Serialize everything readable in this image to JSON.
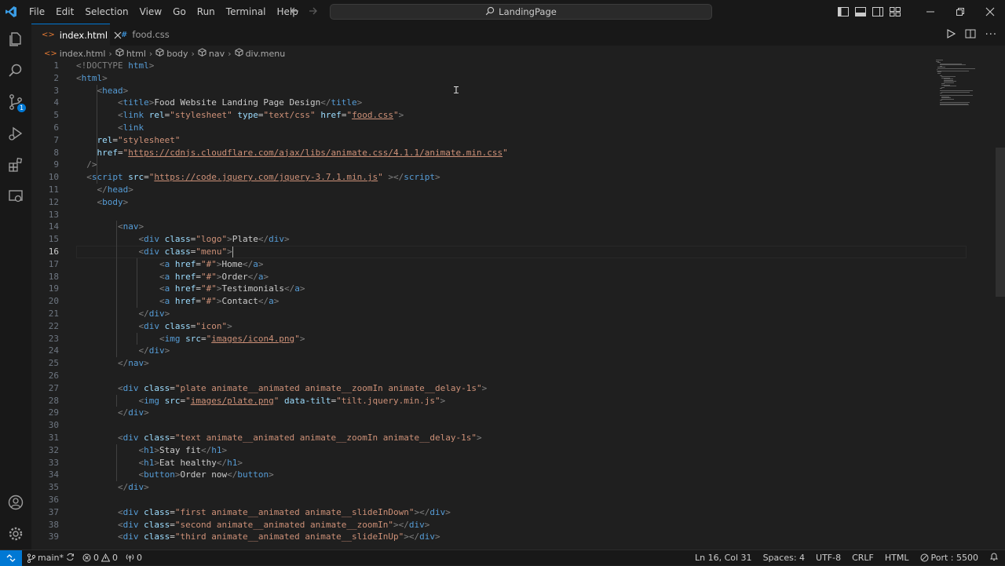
{
  "titlebar": {
    "menu": [
      "File",
      "Edit",
      "Selection",
      "View",
      "Go",
      "Run",
      "Terminal",
      "Help"
    ],
    "search_text": "LandingPage"
  },
  "tabs": [
    {
      "label": "index.html",
      "icon": "<>",
      "active": true
    },
    {
      "label": "food.css",
      "icon": "#",
      "active": false
    }
  ],
  "activity_badge": "1",
  "breadcrumb": [
    "index.html",
    "html",
    "body",
    "nav",
    "div.menu"
  ],
  "editor": {
    "current_line": 16,
    "lines": [
      [
        [
          "tg",
          "<!DOCTYPE "
        ],
        [
          "tn",
          "html"
        ],
        [
          "tg",
          ">"
        ]
      ],
      [
        [
          "tg",
          "<"
        ],
        [
          "tn",
          "html"
        ],
        [
          "tg",
          ">"
        ]
      ],
      [
        [
          "tx",
          "    "
        ],
        [
          "tg",
          "<"
        ],
        [
          "tn",
          "head"
        ],
        [
          "tg",
          ">"
        ]
      ],
      [
        [
          "tx",
          "        "
        ],
        [
          "tg",
          "<"
        ],
        [
          "tn",
          "title"
        ],
        [
          "tg",
          ">"
        ],
        [
          "tx",
          "Food Website Landing Page Design"
        ],
        [
          "tg",
          "</"
        ],
        [
          "tn",
          "title"
        ],
        [
          "tg",
          ">"
        ]
      ],
      [
        [
          "tx",
          "        "
        ],
        [
          "tg",
          "<"
        ],
        [
          "tn",
          "link "
        ],
        [
          "an",
          "rel"
        ],
        [
          "tx",
          "="
        ],
        [
          "av",
          "\"stylesheet\" "
        ],
        [
          "an",
          "type"
        ],
        [
          "tx",
          "="
        ],
        [
          "av",
          "\"text/css\" "
        ],
        [
          "an",
          "href"
        ],
        [
          "tx",
          "="
        ],
        [
          "av",
          "\""
        ],
        [
          "avu",
          "food.css"
        ],
        [
          "av",
          "\""
        ],
        [
          "tg",
          ">"
        ]
      ],
      [
        [
          "tx",
          "        "
        ],
        [
          "tg",
          "<"
        ],
        [
          "tn",
          "link"
        ]
      ],
      [
        [
          "tx",
          "    "
        ],
        [
          "an",
          "rel"
        ],
        [
          "tx",
          "="
        ],
        [
          "av",
          "\"stylesheet\""
        ]
      ],
      [
        [
          "tx",
          "    "
        ],
        [
          "an",
          "href"
        ],
        [
          "tx",
          "="
        ],
        [
          "av",
          "\""
        ],
        [
          "avu",
          "https://cdnjs.cloudflare.com/ajax/libs/animate.css/4.1.1/animate.min.css"
        ],
        [
          "av",
          "\""
        ]
      ],
      [
        [
          "tx",
          "  "
        ],
        [
          "tg",
          "/>"
        ]
      ],
      [
        [
          "tx",
          "  "
        ],
        [
          "tg",
          "<"
        ],
        [
          "tn",
          "script "
        ],
        [
          "an",
          "src"
        ],
        [
          "tx",
          "="
        ],
        [
          "av",
          "\""
        ],
        [
          "avu",
          "https://code.jquery.com/jquery-3.7.1.min.js"
        ],
        [
          "av",
          "\" "
        ],
        [
          "tg",
          "></"
        ],
        [
          "tn",
          "script"
        ],
        [
          "tg",
          ">"
        ]
      ],
      [
        [
          "tx",
          "    "
        ],
        [
          "tg",
          "</"
        ],
        [
          "tn",
          "head"
        ],
        [
          "tg",
          ">"
        ]
      ],
      [
        [
          "tx",
          "    "
        ],
        [
          "tg",
          "<"
        ],
        [
          "tn",
          "body"
        ],
        [
          "tg",
          ">"
        ]
      ],
      [],
      [
        [
          "tx",
          "        "
        ],
        [
          "tg",
          "<"
        ],
        [
          "tn",
          "nav"
        ],
        [
          "tg",
          ">"
        ]
      ],
      [
        [
          "tx",
          "            "
        ],
        [
          "tg",
          "<"
        ],
        [
          "tn",
          "div "
        ],
        [
          "an",
          "class"
        ],
        [
          "tx",
          "="
        ],
        [
          "av",
          "\"logo\""
        ],
        [
          "tg",
          ">"
        ],
        [
          "tx",
          "Plate"
        ],
        [
          "tg",
          "</"
        ],
        [
          "tn",
          "div"
        ],
        [
          "tg",
          ">"
        ]
      ],
      [
        [
          "tx",
          "            "
        ],
        [
          "tg",
          "<"
        ],
        [
          "tn",
          "div "
        ],
        [
          "an",
          "class"
        ],
        [
          "tx",
          "="
        ],
        [
          "av",
          "\"menu\""
        ],
        [
          "tg",
          ">"
        ],
        [
          "cur",
          ""
        ]
      ],
      [
        [
          "tx",
          "                "
        ],
        [
          "tg",
          "<"
        ],
        [
          "tn",
          "a "
        ],
        [
          "an",
          "href"
        ],
        [
          "tx",
          "="
        ],
        [
          "av",
          "\"#\""
        ],
        [
          "tg",
          ">"
        ],
        [
          "tx",
          "Home"
        ],
        [
          "tg",
          "</"
        ],
        [
          "tn",
          "a"
        ],
        [
          "tg",
          ">"
        ]
      ],
      [
        [
          "tx",
          "                "
        ],
        [
          "tg",
          "<"
        ],
        [
          "tn",
          "a "
        ],
        [
          "an",
          "href"
        ],
        [
          "tx",
          "="
        ],
        [
          "av",
          "\"#\""
        ],
        [
          "tg",
          ">"
        ],
        [
          "tx",
          "Order"
        ],
        [
          "tg",
          "</"
        ],
        [
          "tn",
          "a"
        ],
        [
          "tg",
          ">"
        ]
      ],
      [
        [
          "tx",
          "                "
        ],
        [
          "tg",
          "<"
        ],
        [
          "tn",
          "a "
        ],
        [
          "an",
          "href"
        ],
        [
          "tx",
          "="
        ],
        [
          "av",
          "\"#\""
        ],
        [
          "tg",
          ">"
        ],
        [
          "tx",
          "Testimonials"
        ],
        [
          "tg",
          "</"
        ],
        [
          "tn",
          "a"
        ],
        [
          "tg",
          ">"
        ]
      ],
      [
        [
          "tx",
          "                "
        ],
        [
          "tg",
          "<"
        ],
        [
          "tn",
          "a "
        ],
        [
          "an",
          "href"
        ],
        [
          "tx",
          "="
        ],
        [
          "av",
          "\"#\""
        ],
        [
          "tg",
          ">"
        ],
        [
          "tx",
          "Contact"
        ],
        [
          "tg",
          "</"
        ],
        [
          "tn",
          "a"
        ],
        [
          "tg",
          ">"
        ]
      ],
      [
        [
          "tx",
          "            "
        ],
        [
          "tg",
          "</"
        ],
        [
          "tn",
          "div"
        ],
        [
          "tg",
          ">"
        ]
      ],
      [
        [
          "tx",
          "            "
        ],
        [
          "tg",
          "<"
        ],
        [
          "tn",
          "div "
        ],
        [
          "an",
          "class"
        ],
        [
          "tx",
          "="
        ],
        [
          "av",
          "\"icon\""
        ],
        [
          "tg",
          ">"
        ]
      ],
      [
        [
          "tx",
          "                "
        ],
        [
          "tg",
          "<"
        ],
        [
          "tn",
          "img "
        ],
        [
          "an",
          "src"
        ],
        [
          "tx",
          "="
        ],
        [
          "av",
          "\""
        ],
        [
          "avu",
          "images/icon4.png"
        ],
        [
          "av",
          "\""
        ],
        [
          "tg",
          ">"
        ]
      ],
      [
        [
          "tx",
          "            "
        ],
        [
          "tg",
          "</"
        ],
        [
          "tn",
          "div"
        ],
        [
          "tg",
          ">"
        ]
      ],
      [
        [
          "tx",
          "        "
        ],
        [
          "tg",
          "</"
        ],
        [
          "tn",
          "nav"
        ],
        [
          "tg",
          ">"
        ]
      ],
      [],
      [
        [
          "tx",
          "        "
        ],
        [
          "tg",
          "<"
        ],
        [
          "tn",
          "div "
        ],
        [
          "an",
          "class"
        ],
        [
          "tx",
          "="
        ],
        [
          "av",
          "\"plate animate__animated animate__zoomIn animate__delay-1s\""
        ],
        [
          "tg",
          ">"
        ]
      ],
      [
        [
          "tx",
          "            "
        ],
        [
          "tg",
          "<"
        ],
        [
          "tn",
          "img "
        ],
        [
          "an",
          "src"
        ],
        [
          "tx",
          "="
        ],
        [
          "av",
          "\""
        ],
        [
          "avu",
          "images/plate.png"
        ],
        [
          "av",
          "\" "
        ],
        [
          "an",
          "data-tilt"
        ],
        [
          "tx",
          "="
        ],
        [
          "av",
          "\"tilt.jquery.min.js\""
        ],
        [
          "tg",
          ">"
        ]
      ],
      [
        [
          "tx",
          "        "
        ],
        [
          "tg",
          "</"
        ],
        [
          "tn",
          "div"
        ],
        [
          "tg",
          ">"
        ]
      ],
      [],
      [
        [
          "tx",
          "        "
        ],
        [
          "tg",
          "<"
        ],
        [
          "tn",
          "div "
        ],
        [
          "an",
          "class"
        ],
        [
          "tx",
          "="
        ],
        [
          "av",
          "\"text animate__animated animate__zoomIn animate__delay-1s\""
        ],
        [
          "tg",
          ">"
        ]
      ],
      [
        [
          "tx",
          "            "
        ],
        [
          "tg",
          "<"
        ],
        [
          "tn",
          "h1"
        ],
        [
          "tg",
          ">"
        ],
        [
          "tx",
          "Stay fit"
        ],
        [
          "tg",
          "</"
        ],
        [
          "tn",
          "h1"
        ],
        [
          "tg",
          ">"
        ]
      ],
      [
        [
          "tx",
          "            "
        ],
        [
          "tg",
          "<"
        ],
        [
          "tn",
          "h1"
        ],
        [
          "tg",
          ">"
        ],
        [
          "tx",
          "Eat healthy"
        ],
        [
          "tg",
          "</"
        ],
        [
          "tn",
          "h1"
        ],
        [
          "tg",
          ">"
        ]
      ],
      [
        [
          "tx",
          "            "
        ],
        [
          "tg",
          "<"
        ],
        [
          "tn",
          "button"
        ],
        [
          "tg",
          ">"
        ],
        [
          "tx",
          "Order now"
        ],
        [
          "tg",
          "</"
        ],
        [
          "tn",
          "button"
        ],
        [
          "tg",
          ">"
        ]
      ],
      [
        [
          "tx",
          "        "
        ],
        [
          "tg",
          "</"
        ],
        [
          "tn",
          "div"
        ],
        [
          "tg",
          ">"
        ]
      ],
      [],
      [
        [
          "tx",
          "        "
        ],
        [
          "tg",
          "<"
        ],
        [
          "tn",
          "div "
        ],
        [
          "an",
          "class"
        ],
        [
          "tx",
          "="
        ],
        [
          "av",
          "\"first animate__animated animate__slideInDown\""
        ],
        [
          "tg",
          "></"
        ],
        [
          "tn",
          "div"
        ],
        [
          "tg",
          ">"
        ]
      ],
      [
        [
          "tx",
          "        "
        ],
        [
          "tg",
          "<"
        ],
        [
          "tn",
          "div "
        ],
        [
          "an",
          "class"
        ],
        [
          "tx",
          "="
        ],
        [
          "av",
          "\"second animate__animated animate__zoomIn\""
        ],
        [
          "tg",
          "></"
        ],
        [
          "tn",
          "div"
        ],
        [
          "tg",
          ">"
        ]
      ],
      [
        [
          "tx",
          "        "
        ],
        [
          "tg",
          "<"
        ],
        [
          "tn",
          "div "
        ],
        [
          "an",
          "class"
        ],
        [
          "tx",
          "="
        ],
        [
          "av",
          "\"third animate__animated animate__slideInUp\""
        ],
        [
          "tg",
          "></"
        ],
        [
          "tn",
          "div"
        ],
        [
          "tg",
          ">"
        ]
      ]
    ]
  },
  "statusbar": {
    "branch": "main*",
    "errors": "0",
    "warnings": "0",
    "ports": "0",
    "position": "Ln 16, Col 31",
    "spaces": "Spaces: 4",
    "encoding": "UTF-8",
    "eol": "CRLF",
    "language": "HTML",
    "port": "Port : 5500"
  },
  "colors": {
    "accent": "#0078d4",
    "tag": "#569cd6",
    "attr": "#9cdcfe",
    "string": "#ce9178",
    "bracket": "#808080"
  }
}
